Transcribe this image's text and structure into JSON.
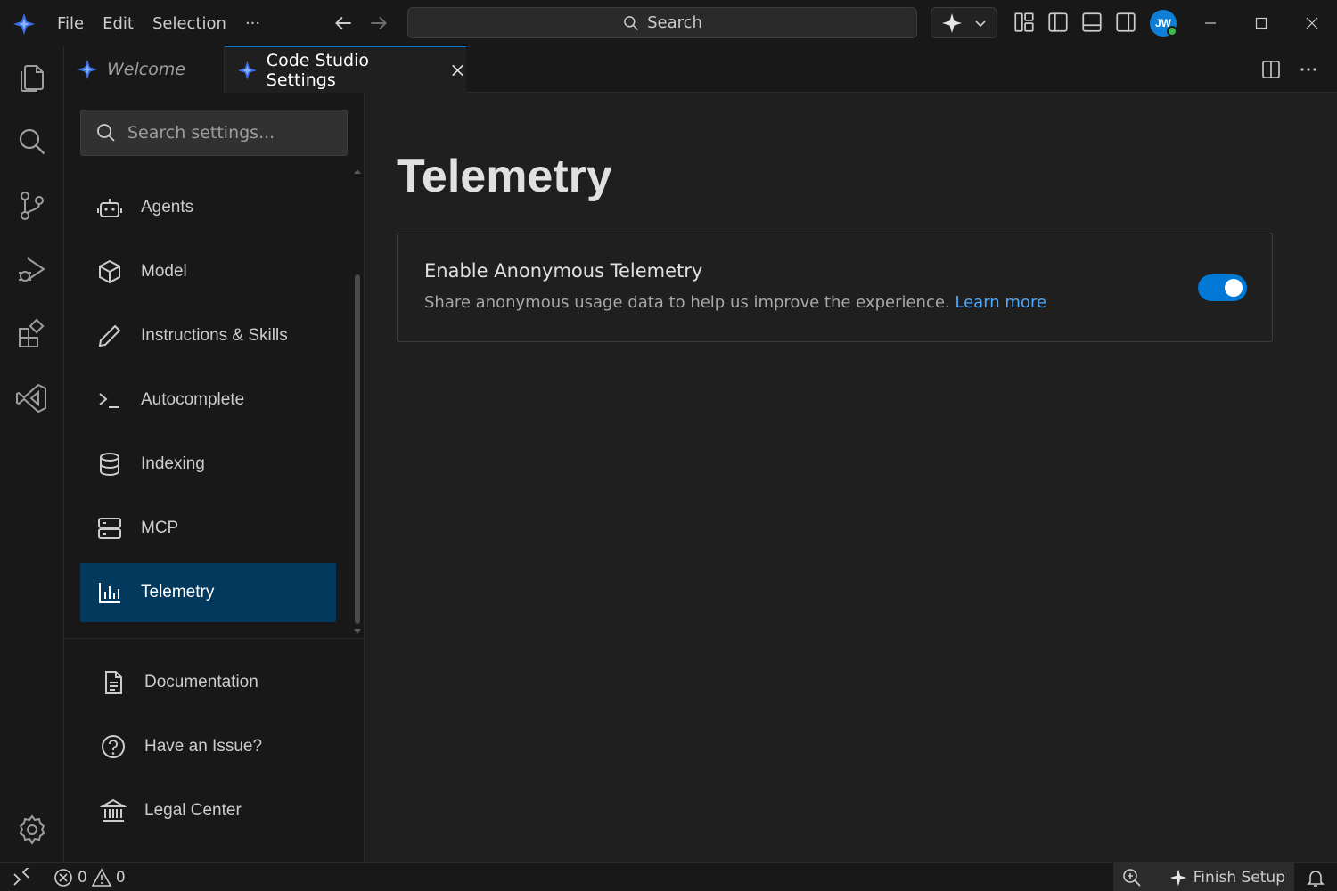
{
  "titlebar": {
    "menu": [
      "File",
      "Edit",
      "Selection"
    ],
    "more": "···",
    "search_label": "Search",
    "avatar_initials": "JW"
  },
  "tabs": [
    {
      "label": "Welcome",
      "active": false
    },
    {
      "label": "Code Studio Settings",
      "active": true
    }
  ],
  "settings_nav": {
    "search_placeholder": "Search settings...",
    "items": [
      {
        "label": "Agents",
        "icon": "robot-icon"
      },
      {
        "label": "Model",
        "icon": "cube-icon"
      },
      {
        "label": "Instructions & Skills",
        "icon": "pencil-icon"
      },
      {
        "label": "Autocomplete",
        "icon": "terminal-icon"
      },
      {
        "label": "Indexing",
        "icon": "database-icon"
      },
      {
        "label": "MCP",
        "icon": "server-icon"
      },
      {
        "label": "Telemetry",
        "icon": "bar-chart-icon"
      }
    ],
    "selected": "Telemetry",
    "footer": [
      {
        "label": "Documentation",
        "icon": "document-icon"
      },
      {
        "label": "Have an Issue?",
        "icon": "question-icon"
      },
      {
        "label": "Legal Center",
        "icon": "bank-icon"
      }
    ]
  },
  "main": {
    "title": "Telemetry",
    "setting": {
      "title": "Enable Anonymous Telemetry",
      "description": "Share anonymous usage data to help us improve the experience.",
      "link": "Learn more",
      "enabled": true
    }
  },
  "statusbar": {
    "errors": "0",
    "warnings": "0",
    "finish_setup": "Finish Setup"
  },
  "colors": {
    "accent": "#0078d4",
    "selected_bg": "#04395e",
    "link": "#4daafc",
    "background": "#1f1f1f",
    "chrome": "#181818"
  }
}
